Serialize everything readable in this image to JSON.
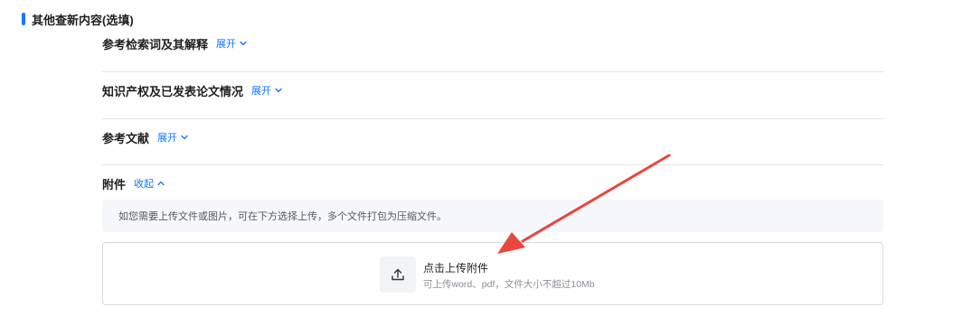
{
  "section": {
    "title": "其他查新内容(选填)",
    "accent_color": "#1677ff"
  },
  "items": [
    {
      "title": "参考检索词及其解释",
      "toggle_label": "展开",
      "toggle_icon": "chevron-down-icon"
    },
    {
      "title": "知识产权及已发表论文情况",
      "toggle_label": "展开",
      "toggle_icon": "chevron-down-icon"
    },
    {
      "title": "参考文献",
      "toggle_label": "展开",
      "toggle_icon": "chevron-down-icon"
    },
    {
      "title": "附件",
      "toggle_label": "收起",
      "toggle_icon": "chevron-up-icon"
    }
  ],
  "attachment": {
    "hint": "如您需要上传文件或图片，可在下方选择上传，多个文件打包为压缩文件。",
    "upload_label": "点击上传附件",
    "upload_sub": "可上传word、pdf，文件大小不超过10Mb",
    "upload_icon": "upload-icon"
  },
  "annotation": {
    "arrow_color": "#e8463f"
  }
}
